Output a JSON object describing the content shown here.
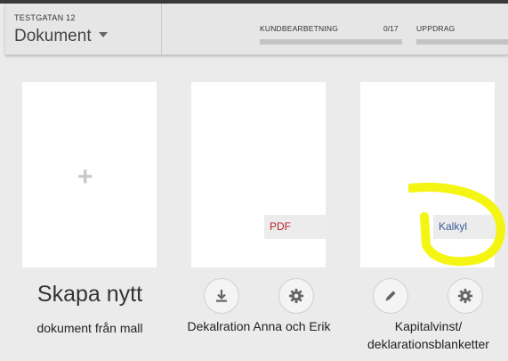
{
  "header": {
    "address": "TESTGATAN 12",
    "title": "Dokument",
    "progress": [
      {
        "label": "KUNDBEARBETNING",
        "count": "0/17",
        "fraction": 0
      },
      {
        "label": "UPPDRAG",
        "count": "",
        "fraction": 0
      }
    ]
  },
  "cards": [
    {
      "id": "create",
      "title": "Skapa nytt",
      "subtitle": "dokument från mall",
      "icon": "plus-icon"
    },
    {
      "id": "dekl",
      "badge": "PDF",
      "caption": "Dekalration Anna och Erik",
      "actions": [
        "download-icon",
        "gear-icon"
      ]
    },
    {
      "id": "kapital",
      "badge": "Kalkyl",
      "caption_line1": "Kapitalvinst/",
      "caption_line2": "deklarationsblanketter",
      "actions": [
        "pencil-icon",
        "gear-icon"
      ]
    }
  ],
  "colors": {
    "background": "#ebebeb",
    "card": "#ffffff",
    "pdf": "#b4282e",
    "kalkyl": "#3b5b98",
    "highlight": "#f4f400"
  }
}
